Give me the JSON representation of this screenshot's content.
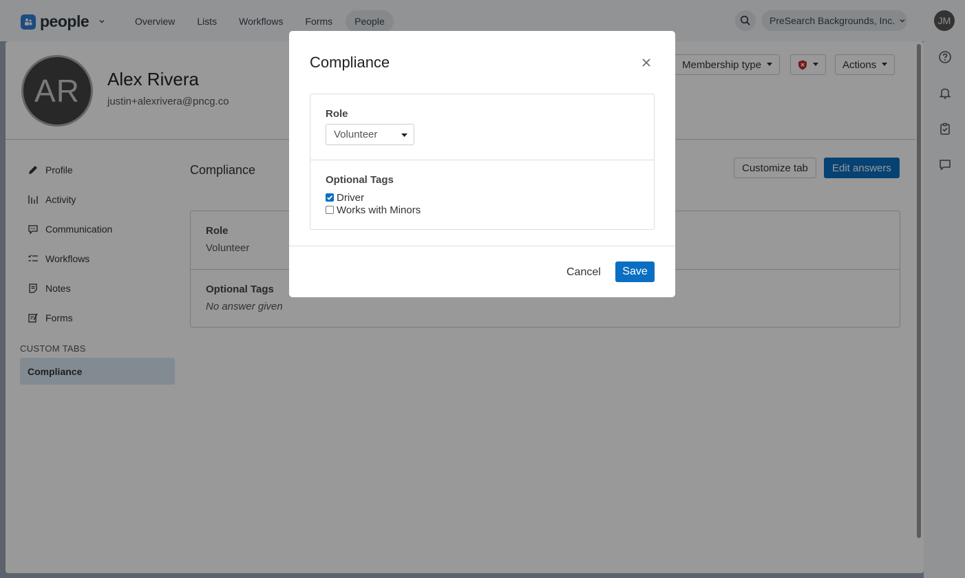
{
  "topnav": {
    "brand": "people",
    "links": [
      "Overview",
      "Lists",
      "Workflows",
      "Forms",
      "People"
    ],
    "active_link": "People",
    "organization": "PreSearch Backgrounds, Inc.",
    "user_initials": "JM"
  },
  "person": {
    "initials": "AR",
    "name": "Alex Rivera",
    "email": "justin+alexrivera@pncg.co"
  },
  "header_actions": {
    "membership_type": "Membership type",
    "actions": "Actions"
  },
  "sidebar": {
    "items": [
      "Profile",
      "Activity",
      "Communication",
      "Workflows",
      "Notes",
      "Forms"
    ],
    "custom_tabs_label": "CUSTOM TABS",
    "custom_tabs": [
      "Compliance"
    ]
  },
  "content": {
    "title": "Compliance",
    "customize_tab": "Customize tab",
    "edit_answers": "Edit answers",
    "answers": [
      {
        "label": "Role",
        "value": "Volunteer"
      },
      {
        "label": "Optional Tags",
        "value": "No answer given"
      }
    ]
  },
  "modal": {
    "title": "Compliance",
    "role_label": "Role",
    "role_value": "Volunteer",
    "tags_label": "Optional Tags",
    "tags": [
      {
        "label": "Driver",
        "checked": true
      },
      {
        "label": "Works with Minors",
        "checked": false
      }
    ],
    "cancel": "Cancel",
    "save": "Save"
  },
  "colors": {
    "primary": "#0a6fc2",
    "brand_icon": "#2f7fd6",
    "active_tab_bg": "#dbe8f3",
    "shield_badge": "#c62828"
  }
}
